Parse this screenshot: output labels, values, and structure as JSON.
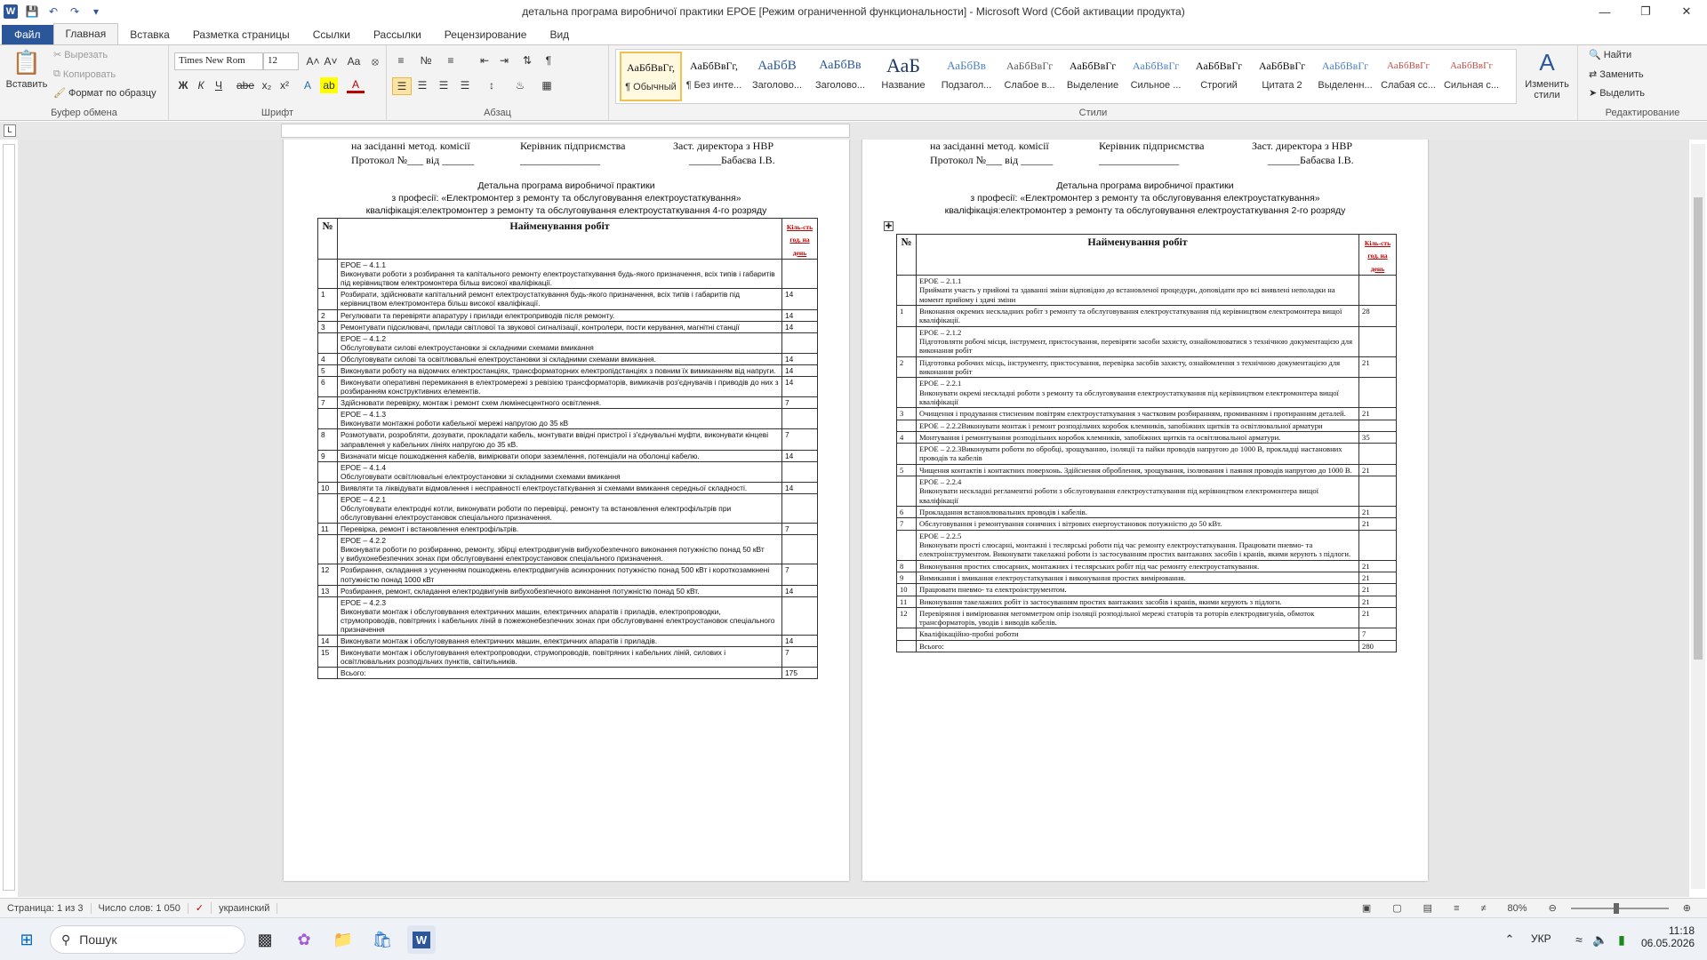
{
  "window": {
    "title": "детальна програма виробничої практики ЕРОЕ [Режим ограниченной функциональности]  -  Microsoft Word (Сбой активации продукта)"
  },
  "tabs": [
    "Файл",
    "Главная",
    "Вставка",
    "Разметка страницы",
    "Ссылки",
    "Рассылки",
    "Рецензирование",
    "Вид"
  ],
  "ribbon": {
    "clipboard": {
      "paste": "Вставить",
      "cut": "Вырезать",
      "copy": "Копировать",
      "format_painter": "Формат по образцу",
      "group": "Буфер обмена"
    },
    "font": {
      "name": "Times New Rom",
      "size": "12",
      "group": "Шрифт",
      "bold": "Ж",
      "italic": "К",
      "underline": "Ч"
    },
    "paragraph": {
      "group": "Абзац"
    },
    "styles": {
      "group": "Стили",
      "items": [
        {
          "preview": "АаБбВвГг,",
          "name": "¶ Обычный"
        },
        {
          "preview": "АаБбВвГг,",
          "name": "¶ Без инте..."
        },
        {
          "preview": "АаБбВ",
          "name": "Заголово..."
        },
        {
          "preview": "АаБбВв",
          "name": "Заголово..."
        },
        {
          "preview": "АаБ",
          "name": "Название"
        },
        {
          "preview": "АаБбВв",
          "name": "Подзагол..."
        },
        {
          "preview": "АаБбВвГг",
          "name": "Слабое в..."
        },
        {
          "preview": "АаБбВвГг",
          "name": "Выделение"
        },
        {
          "preview": "АаБбВвГг",
          "name": "Сильное ..."
        },
        {
          "preview": "АаБбВвГг",
          "name": "Строгий"
        },
        {
          "preview": "АаБбВвГг",
          "name": "Цитата 2"
        },
        {
          "preview": "АаБбВвГг",
          "name": "Выделенн..."
        },
        {
          "preview": "АаБбВвГг",
          "name": "Слабая сс..."
        },
        {
          "preview": "АаБбВвГг",
          "name": "Сильная с..."
        }
      ],
      "change": "Изменить стили"
    },
    "editing": {
      "group": "Редактирование",
      "find": "Найти",
      "replace": "Заменить",
      "select": "Выделить"
    }
  },
  "page1": {
    "hdr1": "на засіданні метод. комісії",
    "hdr2": "Керівник підприємства",
    "hdr3": "Заст. директора з НВР",
    "hdr4": "Протокол №___ від ______",
    "hdr5": "_______________",
    "hdr6": "______Бабаєва І.В.",
    "title1": "Детальна програма виробничої практики",
    "title2": "з професії: «Електромонтер з ремонту та обслуговування електроустаткування»",
    "title3": "кваліфікація:електромонтер з ремонту та обслуговування електроустаткування 4-го розряду",
    "col_no": "№",
    "col_name": "Найменування робіт",
    "col_hours": "Кіль-сть год. на день",
    "rows": [
      {
        "n": "",
        "t": "ЕРОЕ – 4.1.1\nВиконувати роботи з розбирання та капітального ремонту електроустаткування будь-якого призначення, всіх типів і габаритів під керівництвом електромонтера більш високої кваліфікації.",
        "h": ""
      },
      {
        "n": "1",
        "t": "Розбирати, здійснювати капітальний ремонт електроустаткування будь-якого призначення, всіх типів і габаритів під керівництвом електромонтера більш високої кваліфікації.",
        "h": "14"
      },
      {
        "n": "2",
        "t": "Регулювати та перевіряти апаратуру і прилади електроприводів після ремонту.",
        "h": "14"
      },
      {
        "n": "3",
        "t": "Ремонтувати підсилювачі, прилади світлової та звукової сигналізації, контролери, пости керування, магнітні станції",
        "h": "14"
      },
      {
        "n": "",
        "t": "ЕРОЕ – 4.1.2\nОбслуговувати силові електроустановки зі складними схемами вмикання",
        "h": ""
      },
      {
        "n": "4",
        "t": "Обслуговувати силові та освітлювальні електроустановки зі складними схемами вмикання.",
        "h": "14"
      },
      {
        "n": "5",
        "t": "Виконувати роботу на відомчих електростанціях, трансформаторних електропідстанціях з повним їх вимиканням від напруги.",
        "h": "14"
      },
      {
        "n": "6",
        "t": "Виконувати оперативні перемикання в електромережі з ревізією трансформаторів, вимикачів роз'єднувачів і приводів до них з розбиранням конструктивних елементів.",
        "h": "14"
      },
      {
        "n": "7",
        "t": "Здійснювати перевірку, монтаж і ремонт схем люмінесцентного освітлення.",
        "h": "7"
      },
      {
        "n": "",
        "t": "ЕРОЕ – 4.1.3\nВиконувати монтажні роботи кабельної мережі напругою до 35 кВ",
        "h": ""
      },
      {
        "n": "8",
        "t": "Розмотувати, розробляти, дозувати, прокладати кабель, монтувати ввідні пристрої і з'єднувальні муфти, виконувати кінцеві заправлення у кабельних лініях напругою до 35 кВ.",
        "h": "7"
      },
      {
        "n": "9",
        "t": "Визначати місце пошкодження кабелів, вимірювати опори заземлення, потенціали на оболонці кабелю.",
        "h": "14"
      },
      {
        "n": "",
        "t": "ЕРОЕ – 4.1.4\nОбслуговувати освітлювальні електроустановки зі складними схемами вмикання",
        "h": ""
      },
      {
        "n": "10",
        "t": " Виявляти та ліквідувати відмовлення і несправності електроустаткування зі схемами вмикання середньої складності.",
        "h": "14"
      },
      {
        "n": "",
        "t": "ЕРОЕ – 4.2.1\nОбслуговувати електродні котли, виконувати роботи по перевірці, ремонту та встановлення електрофільтрів при обслуговуванні електроустановок спеціального призначення.",
        "h": ""
      },
      {
        "n": "11",
        "t": "Перевірка, ремонт і встановлення електрофільтрів.",
        "h": "7"
      },
      {
        "n": "",
        "t": "ЕРОЕ – 4.2.2\nВиконувати роботи по розбиранню, ремонту, збірці електродвигунів вибухобезпечного виконання потужністю понад 50 кВт\nу вибухонебезпечних зонах при обслуговуванні електроустановок спеціального призначення.",
        "h": ""
      },
      {
        "n": "12",
        "t": "Розбирання, складання з усуненням пошкоджень електродвигунів асинхронних потужністю понад 500 кВт і короткозамкнені потужністю понад 1000 кВт",
        "h": "7"
      },
      {
        "n": "13",
        "t": "Розбирання, ремонт, складання електродвигунів вибухобезпечного виконання потужністю понад 50 кВт.",
        "h": "14"
      },
      {
        "n": "",
        "t": "ЕРОЕ – 4.2.3\nВиконувати монтаж і обслуговування електричних машин, електричних апаратів і приладів, електропроводки, струмопроводів, повітряних і кабельних ліній в пожежонебезпечних зонах при обслуговуванні електроустановок спеціального призначення",
        "h": ""
      },
      {
        "n": "14",
        "t": "Виконувати монтаж і обслуговування електричних машин, електричних апаратів і приладів.",
        "h": "14"
      },
      {
        "n": "15",
        "t": "Виконувати монтаж і обслуговування електропроводки, струмопроводів, повітряних і кабельних ліній, силових і освітлювальних розподільчих пунктів, світильників.",
        "h": "7"
      },
      {
        "n": "",
        "t": "Всього:",
        "h": "175"
      }
    ]
  },
  "page2": {
    "hdr1": "на засіданні метод. комісії",
    "hdr2": "Керівник підприємства",
    "hdr3": "Заст. директора з НВР",
    "hdr4": "Протокол №___ від ______",
    "hdr5": "_______________",
    "hdr6": "______Бабаєва І.В.",
    "title1": "Детальна програма виробничої практики",
    "title2": "з професії: «Електромонтер з ремонту та обслуговування електроустаткування»",
    "title3": "кваліфікація:електромонтер з ремонту та обслуговування електроустаткування 2-го розряду",
    "col_no": "№",
    "col_name": "Найменування робіт",
    "col_hours": "Кіль-сть год. на день",
    "rows": [
      {
        "n": "",
        "t": "ЕРОЕ – 2.1.1\nПриймати участь у прийомі та здаванні зміни відповідно до встановленої процедури, доповідати про всі виявлені неполадки на момент прийому і здачі зміни",
        "h": ""
      },
      {
        "n": "1",
        "t": "Виконання окремих нескладних робіт з ремонту та обслуговування електроустаткування під керівництвом електромонтера вищої кваліфікації.",
        "h": "28"
      },
      {
        "n": "",
        "t": "ЕРОЕ – 2.1.2\nПідготовляти робочі місця, інструмент, пристосування, перевіряти засоби захисту, ознайомлюватися з технічною документацією для виконання робіт",
        "h": ""
      },
      {
        "n": "2",
        "t": "Підготовка робочих місць, інструменту, пристосування, перевірка засобів захисту, ознайомлення з технічною документацією для виконання робіт",
        "h": "21"
      },
      {
        "n": "",
        "t": "ЕРОЕ – 2.2.1\nВиконувати окремі нескладні роботи з ремонту та обслуговування електроустаткування під керівництвом електромонтера вищої кваліфікації",
        "h": ""
      },
      {
        "n": "3",
        "t": "Очищення і продування стисненим повітрям електроустаткування з частковим розбиранням, промиванням і протиранням деталей.",
        "h": "21"
      },
      {
        "n": "",
        "t": "ЕРОЕ – 2.2.2Виконувати монтаж і ремонт розподільчих коробок клемників, запобіжних щитків та освітлювальної арматури",
        "h": ""
      },
      {
        "n": "4",
        "t": "Монтування і ремонтування розподільних коробок клемників, запобіжних щитків та освітлювальної арматури.",
        "h": "35"
      },
      {
        "n": "",
        "t": "ЕРОЕ – 2.2.3Виконувати роботи по обробці, зрощуванню, ізоляції та пайки проводів напругою до 1000 В, прокладці настановних проводів та кабелів",
        "h": ""
      },
      {
        "n": "5",
        "t": "Чищення контактів і контактних поверхонь. Здійснення оброблення, зрощування, ізолювання і паяння проводів напругою до 1000 В.",
        "h": "21"
      },
      {
        "n": "",
        "t": "ЕРОЕ – 2.2.4\nВиконувати нескладні регламентні роботи з обслуговування електроустаткування під керівництвом електромонтера вищої кваліфікації",
        "h": ""
      },
      {
        "n": "6",
        "t": "Прокладання встановлювальних проводів і кабелів.",
        "h": "21"
      },
      {
        "n": "7",
        "t": "Обслуговування і ремонтування сонячних і вітрових енергоустановок потужністю до 50 кВт.",
        "h": "21"
      },
      {
        "n": "",
        "t": "ЕРОЕ – 2.2.5\nВиконувати прості слюсарні, монтажні і теслярські роботи під час ремонту електроустаткування. Працювати пневмо- та електроінструментом. Виконувати такелажні роботи із застосуванням простих вантажних засобів і кранів, якими керують з підлоги.",
        "h": ""
      },
      {
        "n": "8",
        "t": "Виконування простих слюсарних, монтажних і теслярських робіт під час ремонту електроустаткування.",
        "h": "21"
      },
      {
        "n": "9",
        "t": "Вимикання і вмикання електроустаткування і виконування простих вимірювання.",
        "h": "21"
      },
      {
        "n": "10",
        "t": "Працювати пневмо- та електроінструментом.",
        "h": "21"
      },
      {
        "n": "11",
        "t": "Виконування такелажних робіт із застосуванням простих вантажних засобів і кранів, якими керують з підлоги.",
        "h": "21"
      },
      {
        "n": "12",
        "t": "Перевіряння і вимірювання мегомметром опір ізоляції розподільної мережі статорів та роторів електродвигунів, обмоток трансформаторів, уводів і виводів кабелів.",
        "h": "21"
      },
      {
        "n": "",
        "t": "Кваліфікаційно-пробні роботи",
        "h": "7"
      },
      {
        "n": "",
        "t": "Всього:",
        "h": "280"
      }
    ]
  },
  "status": {
    "page": "Страница: 1 из 3",
    "words": "Число слов: 1 050",
    "lang": "украинский",
    "zoom": "80%"
  },
  "taskbar": {
    "search": "Пошук",
    "lang": "УКР",
    "time": "11:18",
    "date": "06.05.2026"
  }
}
